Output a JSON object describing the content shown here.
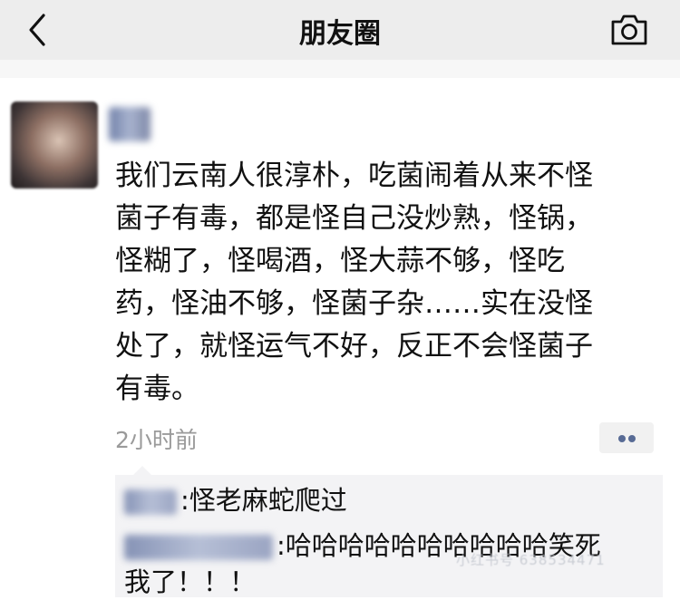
{
  "nav": {
    "title": "朋友圈",
    "back_icon": "chevron-left-icon",
    "camera_icon": "camera-icon"
  },
  "post": {
    "text": "我们云南人很淳朴，吃菌闹着从来不怪\n菌子有毒，都是怪自己没炒熟，怪锅，\n怪糊了，怪喝酒，怪大蒜不够，怪吃\n药，怪油不够，怪菌子杂……实在没怪\n处了，就怪运气不好，反正不会怪菌子\n有毒。",
    "time": "2小时前",
    "more_icon": "more-dots-icon"
  },
  "comments": [
    {
      "separator": ":",
      "text": "怪老麻蛇爬过"
    },
    {
      "separator": ":",
      "text": "哈哈哈哈哈哈哈哈哈哈笑死\n我了！！！"
    }
  ],
  "watermark": "小红书号 638534471",
  "colors": {
    "nav_bg": "#ededed",
    "comments_bg": "#f3f3f5",
    "link_blue": "#586b95",
    "time_gray": "#9a9a9a"
  }
}
